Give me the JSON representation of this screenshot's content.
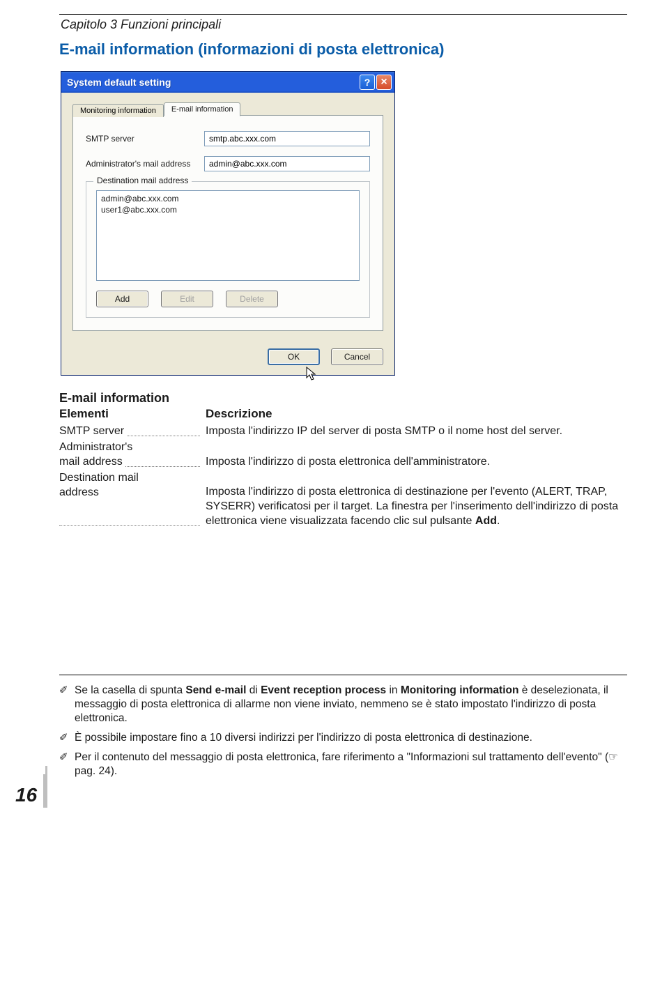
{
  "chapter": "Capitolo 3 Funzioni principali",
  "sectionTitle": "E-mail information (informazioni di posta elettronica)",
  "dialog": {
    "title": "System default setting",
    "tabs": {
      "monitoring": "Monitoring information",
      "email": "E-mail information"
    },
    "fields": {
      "smtpLabel": "SMTP server",
      "smtpValue": "smtp.abc.xxx.com",
      "adminLabel": "Administrator's mail address",
      "adminValue": "admin@abc.xxx.com"
    },
    "groupTitle": "Destination mail address",
    "listItems": [
      "admin@abc.xxx.com",
      "user1@abc.xxx.com"
    ],
    "buttons": {
      "add": "Add",
      "edit": "Edit",
      "delete": "Delete",
      "ok": "OK",
      "cancel": "Cancel"
    }
  },
  "info": {
    "heading": "E-mail information",
    "colElementi": "Elementi",
    "colDescrizione": "Descrizione",
    "rows": {
      "smtp": {
        "term": "SMTP server",
        "desc": "Imposta l'indirizzo IP del server di posta SMTP o il nome host del server."
      },
      "admin": {
        "term1": "Administrator's",
        "term2": "mail address",
        "desc": "Imposta l'indirizzo di posta elettronica dell'amministratore."
      },
      "dest": {
        "term1": "Destination mail",
        "term2": "address",
        "desc1": "Imposta l'indirizzo di posta elettronica di destinazione per l'evento (ALERT, TRAP, SYSERR) verificatosi per il target. La finestra per l'inserimento dell'indirizzo di posta elettronica viene visualizzata facendo clic sul pulsante ",
        "descBold": "Add",
        "desc2": "."
      }
    }
  },
  "notes": {
    "n1a": "Se la casella di spunta ",
    "n1b1": "Send e-mail",
    "n1c": " di ",
    "n1b2": "Event reception process",
    "n1d": " in ",
    "n1b3": "Monitoring information",
    "n1e": " è deselezionata, il messaggio di posta elettronica di allarme non viene inviato, nemmeno se è stato impostato l'indirizzo di posta elettronica.",
    "n2": "È possibile impostare fino a 10 diversi indirizzi per l'indirizzo di posta elettronica di destinazione.",
    "n3": "Per il contenuto del messaggio di posta elettronica, fare riferimento a \"Informazioni sul trattamento dell'evento\" (☞pag. 24)."
  },
  "pageNumber": "16"
}
